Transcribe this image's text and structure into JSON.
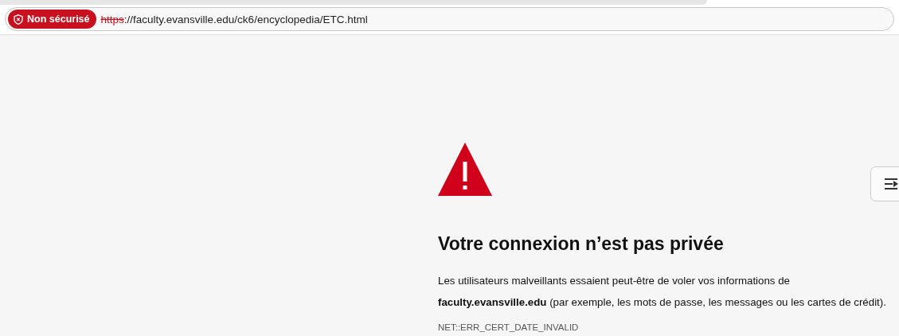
{
  "address_bar": {
    "security_badge": "Non sécurisé",
    "scheme": "https",
    "rest_of_address": "://faculty.evansville.edu/ck6/encyclopedia/ETC.html",
    "insecure": true
  },
  "error_page": {
    "heading": "Votre connexion n’est pas privée",
    "paragraph": "Les utilisateurs malveillants essaient peut-être de voler vos informations de **faculty.evansville.edu** (par exemple, les mots de passe, les messages ou les cartes de crédit).",
    "error_code": "NET::ERR_CERT_DATE_INVALID"
  }
}
